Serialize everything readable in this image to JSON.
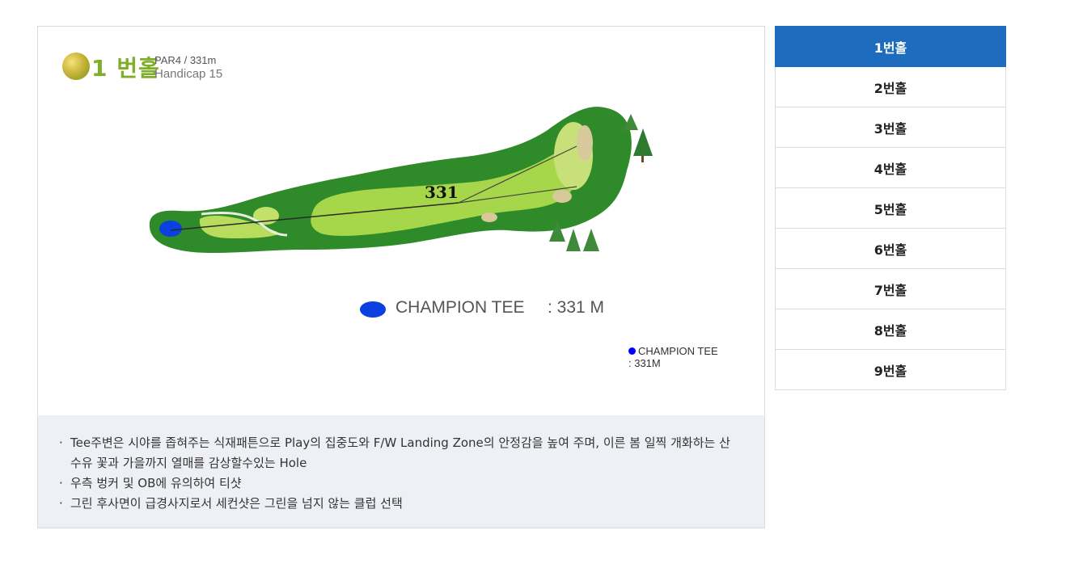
{
  "hole_header": {
    "title": "1 번홀",
    "par_distance": "PAR4 / 331m",
    "handicap": "Handicap 15"
  },
  "map": {
    "distance_label": "331"
  },
  "legend": {
    "tee_name": "CHAMPION TEE",
    "tee_distance": ": 331 M",
    "tee_color": "#0a3fe0",
    "small_name": "CHAMPION TEE",
    "small_distance": ": 331M"
  },
  "description": [
    "Tee주변은 시야를 좁혀주는 식재패튼으로 Play의 집중도와 F/W Landing Zone의 안정감을 높여 주며, 이른 봄 일찍 개화하는 산수유 꽃과 가을까지 열매를 감상할수있는 Hole",
    "우측 벙커 및 OB에 유의하여 티샷",
    "그린 후사면이 급경사지로서 세컨샷은 그린을 넘지 않는 클럽 선택"
  ],
  "holes": [
    "1번홀",
    "2번홀",
    "3번홀",
    "4번홀",
    "5번홀",
    "6번홀",
    "7번홀",
    "8번홀",
    "9번홀"
  ],
  "active_hole": "1번홀",
  "colors": {
    "active_tab": "#1d6cbe",
    "rough": "#2f8a2a",
    "fairway": "#a6d64a",
    "green": "#c8e07a",
    "bunker": "#d8c99a",
    "description_bg": "#eef0f6"
  }
}
